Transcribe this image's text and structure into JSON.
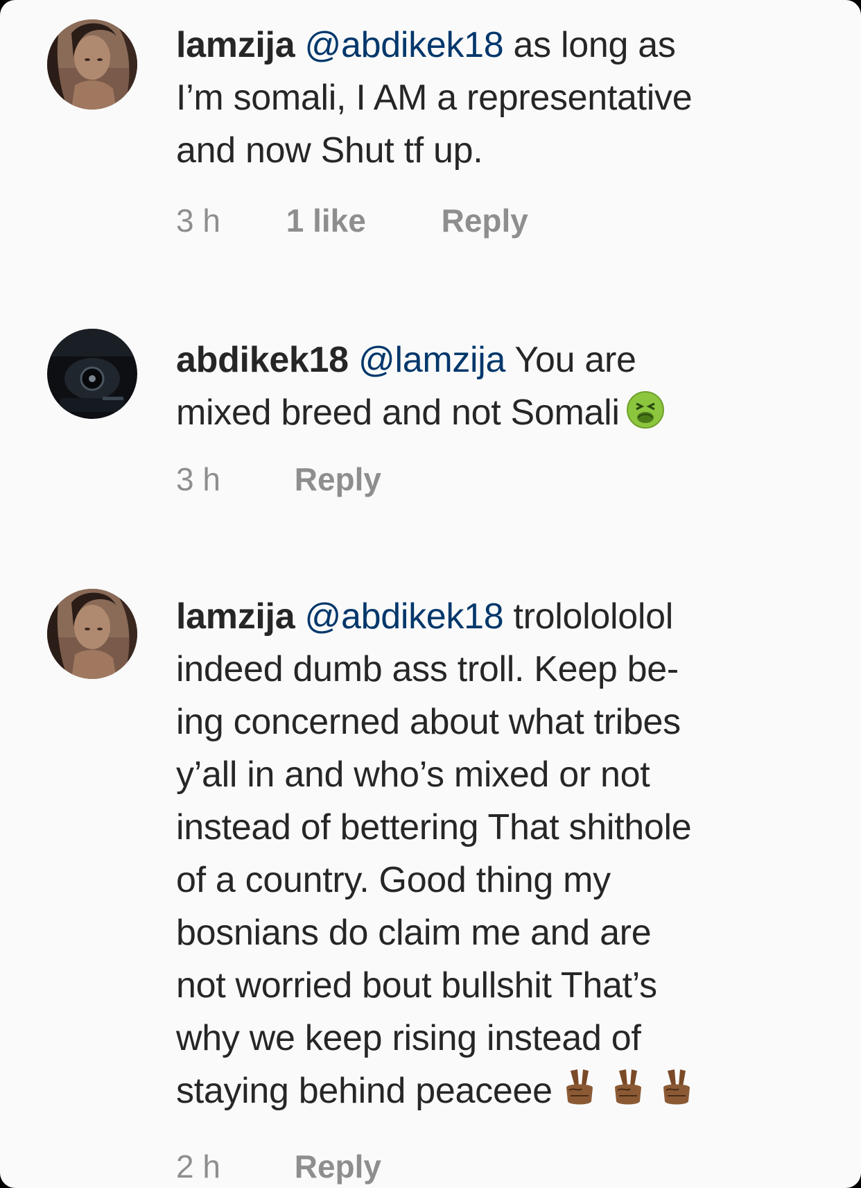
{
  "comments": [
    {
      "username": "lamzija",
      "lines": [
        {
          "mention": "@abdikek18",
          "text": " as long as"
        },
        {
          "text": "I’m somali, I AM a representative"
        },
        {
          "text": "and now Shut tf up."
        }
      ],
      "time": "3 h",
      "likes": "1 like",
      "reply": "Reply",
      "avatar": "female-profile-photo"
    },
    {
      "username": "abdikek18",
      "lines": [
        {
          "mention": "@lamzija",
          "text": " You are"
        },
        {
          "text": "mixed breed and not Somali",
          "emoji": "nauseated-face-emoji"
        }
      ],
      "time": "3 h",
      "reply": "Reply",
      "avatar": "dark-car-photo"
    },
    {
      "username": "lamzija",
      "lines": [
        {
          "mention": "@abdikek18",
          "text": " trololololol"
        },
        {
          "text": "indeed dumb ass troll. Keep be-"
        },
        {
          "text": "ing concerned about what tribes"
        },
        {
          "text": "y’all in and who’s mixed or not"
        },
        {
          "text": "instead of bettering That shithole"
        },
        {
          "text": "of a country. Good thing my"
        },
        {
          "text": "bosnians do claim me and are"
        },
        {
          "text": "not worried bout bullshit That’s"
        },
        {
          "text": "why we keep rising instead of"
        },
        {
          "text": "staying behind peaceee",
          "emoji": "victory-hand-emoji-x3"
        }
      ],
      "time": "2 h",
      "reply": "Reply",
      "avatar": "female-profile-photo"
    }
  ],
  "colors": {
    "background": "#fafafa",
    "text": "#262626",
    "mention": "#00376b",
    "meta": "#8e8e8e"
  }
}
